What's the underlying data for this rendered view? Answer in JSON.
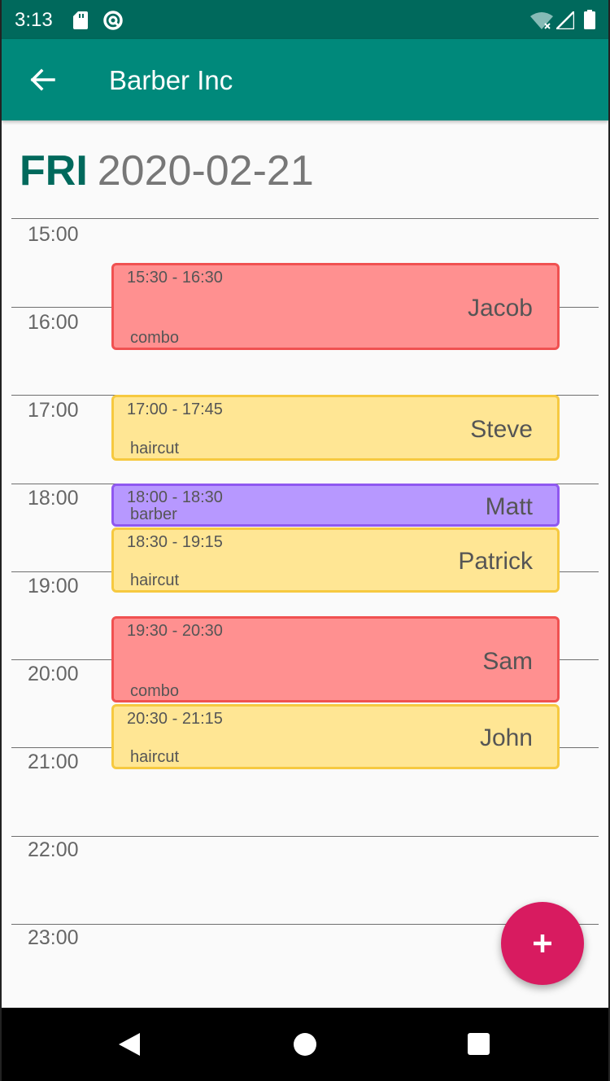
{
  "status_bar": {
    "time": "3:13",
    "icons": [
      "sd-card-icon",
      "sync-icon",
      "wifi-icon",
      "signal-icon",
      "battery-icon"
    ]
  },
  "app_bar": {
    "title": "Barber Inc",
    "back_icon": "arrow-back-icon"
  },
  "date_header": {
    "day": "FRI",
    "date": "2020-02-21"
  },
  "timeline": {
    "hours": [
      "15:00",
      "16:00",
      "17:00",
      "18:00",
      "19:00",
      "20:00",
      "21:00",
      "22:00",
      "23:00"
    ]
  },
  "appointments": [
    {
      "time": "15:30 - 16:30",
      "name": "Jacob",
      "service": "combo",
      "color": "#ff9090"
    },
    {
      "time": "17:00 - 17:45",
      "name": "Steve",
      "service": "haircut",
      "color": "#ffe694"
    },
    {
      "time": "18:00 - 18:30",
      "name": "Matt",
      "service": "barber",
      "color": "#b798ff"
    },
    {
      "time": "18:30 - 19:15",
      "name": "Patrick",
      "service": "haircut",
      "color": "#ffe694"
    },
    {
      "time": "19:30 - 20:30",
      "name": "Sam",
      "service": "combo",
      "color": "#ff9090"
    },
    {
      "time": "20:30 - 21:15",
      "name": "John",
      "service": "haircut",
      "color": "#ffe694"
    }
  ],
  "fab": {
    "icon": "plus-icon"
  },
  "nav_bar": {
    "icons": [
      "nav-back-icon",
      "nav-home-icon",
      "nav-recents-icon"
    ]
  },
  "colors": {
    "status_bar": "#00695c",
    "app_bar": "#00897b",
    "accent": "#d81b60",
    "combo": "#ff9090",
    "haircut": "#ffe694",
    "barber": "#b798ff"
  }
}
